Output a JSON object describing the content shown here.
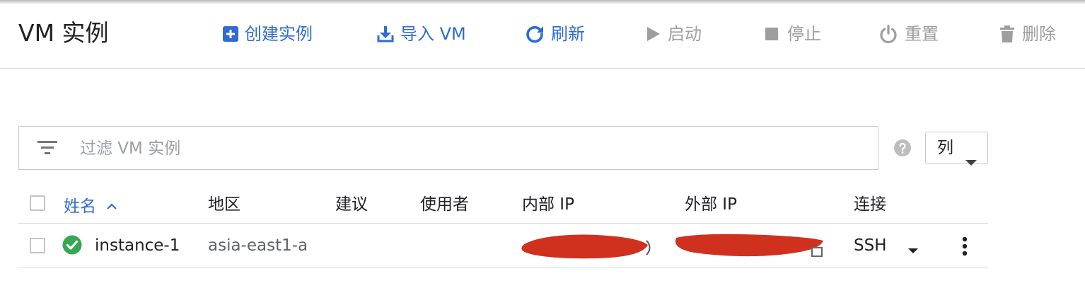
{
  "header": {
    "title": "VM 实例",
    "actions": [
      {
        "label": "创建实例",
        "icon": "add-box-icon",
        "enabled": true
      },
      {
        "label": "导入 VM",
        "icon": "download-icon",
        "enabled": true
      },
      {
        "label": "刷新",
        "icon": "refresh-icon",
        "enabled": true
      },
      {
        "label": "启动",
        "icon": "play-icon",
        "enabled": false
      },
      {
        "label": "停止",
        "icon": "stop-icon",
        "enabled": false
      },
      {
        "label": "重置",
        "icon": "power-icon",
        "enabled": false
      },
      {
        "label": "删除",
        "icon": "trash-icon",
        "enabled": false
      }
    ]
  },
  "filter": {
    "placeholder": "过滤 VM 实例",
    "value": ""
  },
  "columns_button": {
    "label": "列"
  },
  "table": {
    "headers": {
      "name": "姓名",
      "zone": "地区",
      "recommendation": "建议",
      "in_use_by": "使用者",
      "internal_ip": "内部 IP",
      "external_ip": "外部 IP",
      "connect": "连接"
    },
    "sort": {
      "column": "name",
      "direction": "ascending"
    },
    "rows": [
      {
        "status": "running",
        "name": "instance-1",
        "zone": "asia-east1-a",
        "recommendation": "",
        "in_use_by": "",
        "internal_ip": "",
        "external_ip": "",
        "connect": "SSH"
      }
    ]
  },
  "colors": {
    "accent": "#2e6bd3",
    "disabled": "#9e9e9e",
    "status_ok": "#34a853",
    "redaction": "#d0311f"
  }
}
